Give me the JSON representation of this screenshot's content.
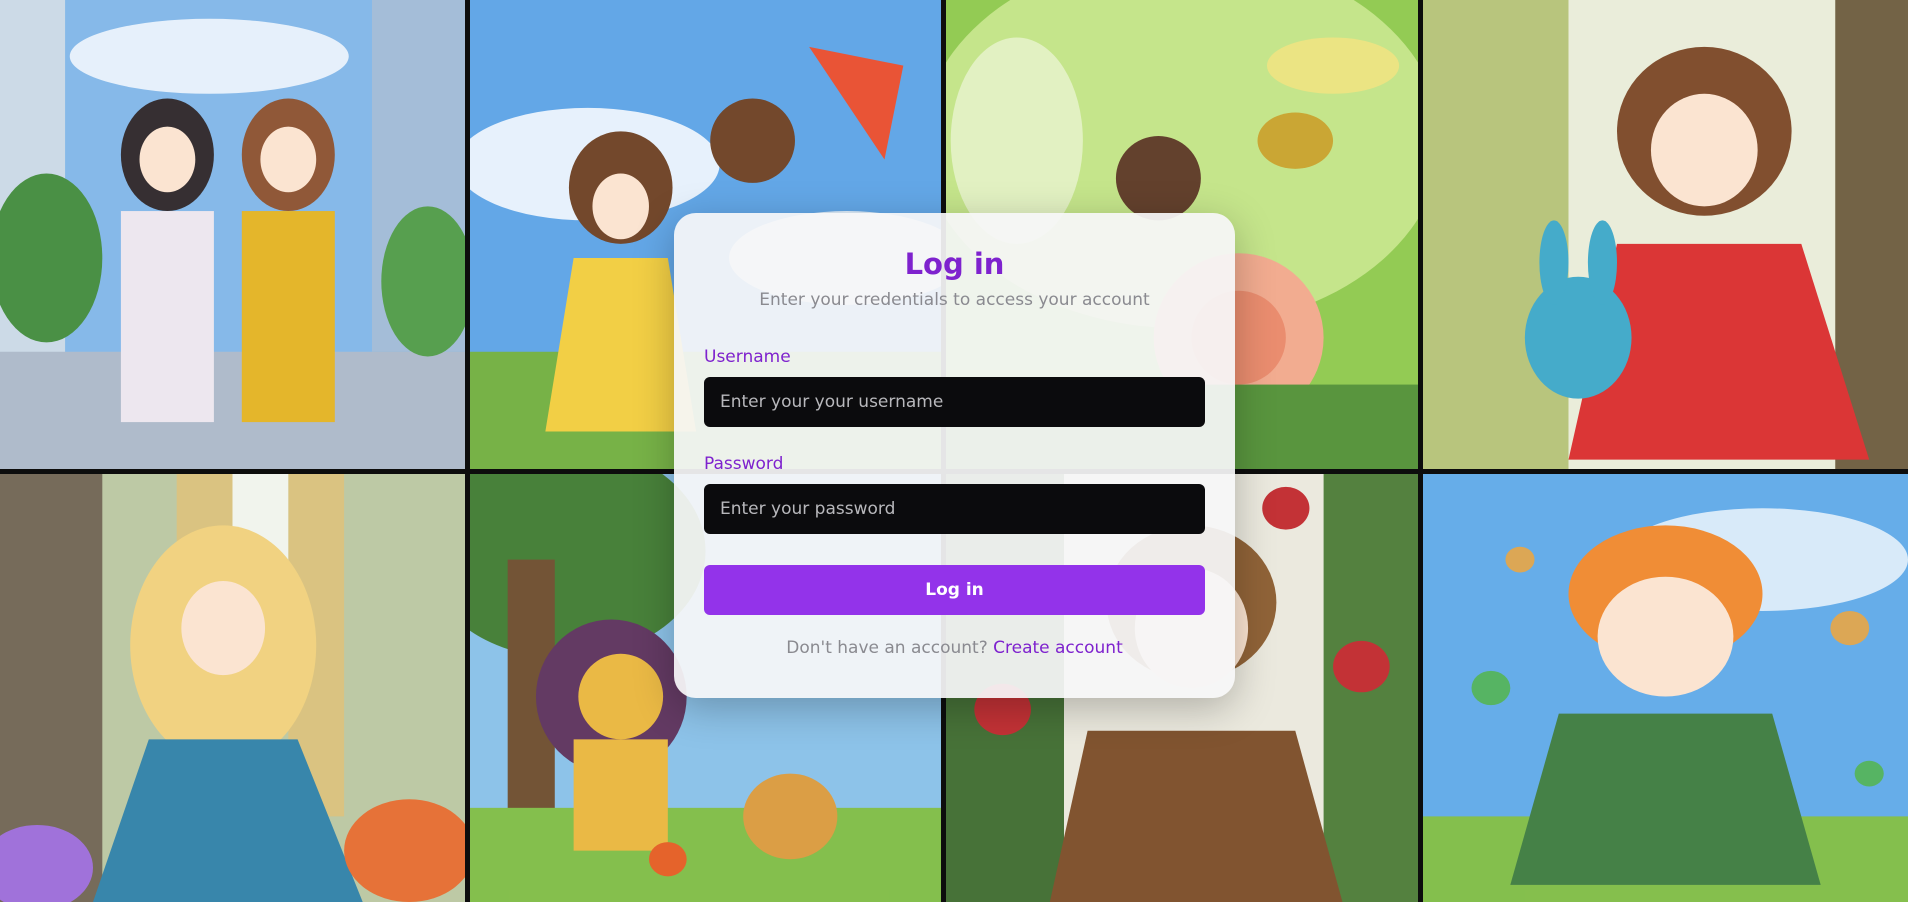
{
  "login": {
    "title": "Log in",
    "subtitle": "Enter your credentials to access your account",
    "username_label": "Username",
    "username_placeholder": "Enter your your username",
    "password_label": "Password",
    "password_placeholder": "Enter your password",
    "submit_label": "Log in",
    "footer_text": "Don't have an account?",
    "footer_link": "Create account"
  },
  "colors": {
    "accent": "#9333ea",
    "accent_text": "#7e22ce",
    "input_bg": "#0b0b0d"
  },
  "gallery": [
    {
      "name": "anime-two-girls-city"
    },
    {
      "name": "anime-kids-kite"
    },
    {
      "name": "anime-fairy-bee-rose"
    },
    {
      "name": "anime-girl-bunny-tree"
    },
    {
      "name": "anime-princess-window"
    },
    {
      "name": "anime-lion-and-cub"
    },
    {
      "name": "anime-boy-roses"
    },
    {
      "name": "anime-boy-bubbles"
    }
  ]
}
